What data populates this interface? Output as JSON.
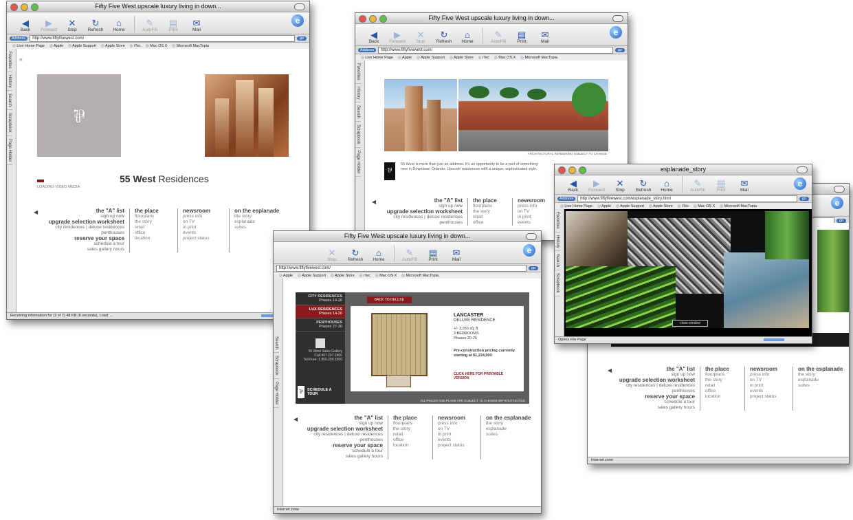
{
  "browser": {
    "toolbar_buttons": [
      {
        "label": "Back",
        "icon": "back-arrow-icon"
      },
      {
        "label": "Forward",
        "icon": "forward-arrow-icon"
      },
      {
        "label": "Stop",
        "icon": "stop-x-icon"
      },
      {
        "label": "Refresh",
        "icon": "refresh-icon"
      },
      {
        "label": "Home",
        "icon": "home-icon"
      },
      {
        "label": "AutoFill",
        "icon": "autofill-icon"
      },
      {
        "label": "Print",
        "icon": "printer-icon"
      },
      {
        "label": "Mail",
        "icon": "mail-icon"
      }
    ],
    "address_label": "Address",
    "go_label": "go",
    "favorites": [
      "Live Home Page",
      "Apple",
      "Apple Support",
      "Apple Store",
      "iTec",
      "Mac OS X",
      "Microsoft MacTopia"
    ],
    "sidetabs": [
      "Favorites",
      "History",
      "Search",
      "Scrapbook",
      "Page Holder"
    ]
  },
  "win1": {
    "title": "Fifty Five West upscale luxury living in down...",
    "url": "http://www.fiftyfivewest.com/",
    "back_glyph": "«",
    "brand_light": "55 West",
    "brand_rest": " Residences",
    "loading_text": "LOADING VIDEO MEDIA",
    "status": "Receiving information for (2 of 7) 48 KB (6 seconds), Load: ..."
  },
  "win2": {
    "title": "Fifty Five West upscale luxury living in down...",
    "url": "http://www.fiftyfivewest.com/",
    "caption": "ARCHITECTURAL RENDERING SUBJECT TO CHANGE",
    "intro": "55 West is more than just an address. It's an opportunity to be a part of something new in Downtown Orlando. Upscale residences with a unique, sophisticated style."
  },
  "win3": {
    "title": "Fifty Five West upscale luxury living in down...",
    "url": "http://www.fiftyfivewest.com/",
    "back_to_gallery": "BACK TO DELUXE",
    "left_menu": [
      {
        "name": "CITY RESIDENCES",
        "sub": "Phases 14-26"
      },
      {
        "name": "LUX RESIDENCES",
        "sub": "Phases 14-26"
      },
      {
        "name": "PENTHOUSES",
        "sub": "Phases 27-30"
      }
    ],
    "gallery_text": "55 West Sales Gallery",
    "phone": "Call 407.207.2400",
    "toll_free": "Toll Free: 1.866.299.3300",
    "schedule": "SCHEDULE A TOUR",
    "unit_name": "LANCASTER",
    "unit_type": "DELUXE RESIDENCE",
    "unit_specs": "+/- 2,050 sq. ft.\n3 BEDROOMS\nPhases 20-26",
    "pricing": "Pre-construction pricing currently starting at $1,224,000",
    "print_link": "CLICK HERE FOR PRINTABLE VERSION",
    "disclaimer": "ALL PRICES AND PLANS ARE SUBJECT TO CHANGE WITHOUT NOTICE"
  },
  "win4": {
    "title": "esplanade_story",
    "url": "http://www.fiftyfivewest.com/esplanade_story.html",
    "close_label": "close window",
    "status": "Opens File Page"
  },
  "win5": {
    "status": "Internet zone"
  },
  "nav": {
    "a_list": "the \"A\" list",
    "sign_up": "sign up now",
    "upgrade": "upgrade selection worksheet",
    "upgrade_sub": "city residences | deluxe residences",
    "penthouses": "penthouses",
    "reserve": "reserve your space",
    "schedule": "schedule a tour",
    "hours": "sales gallery hours",
    "place": "the place",
    "place_items": [
      "floorplans",
      "the story",
      "retail",
      "office",
      "location"
    ],
    "newsroom": "newsroom",
    "news_items": [
      "press info",
      "on TV",
      "in print",
      "events",
      "project status"
    ],
    "esplanade": "on the esplanade",
    "esp_items": [
      "the story",
      "esplanade",
      "suites"
    ]
  },
  "colors": {
    "accent": "#3b6fb6",
    "brand_red": "#8b1a1a",
    "grey_panel": "#b4adb0"
  }
}
